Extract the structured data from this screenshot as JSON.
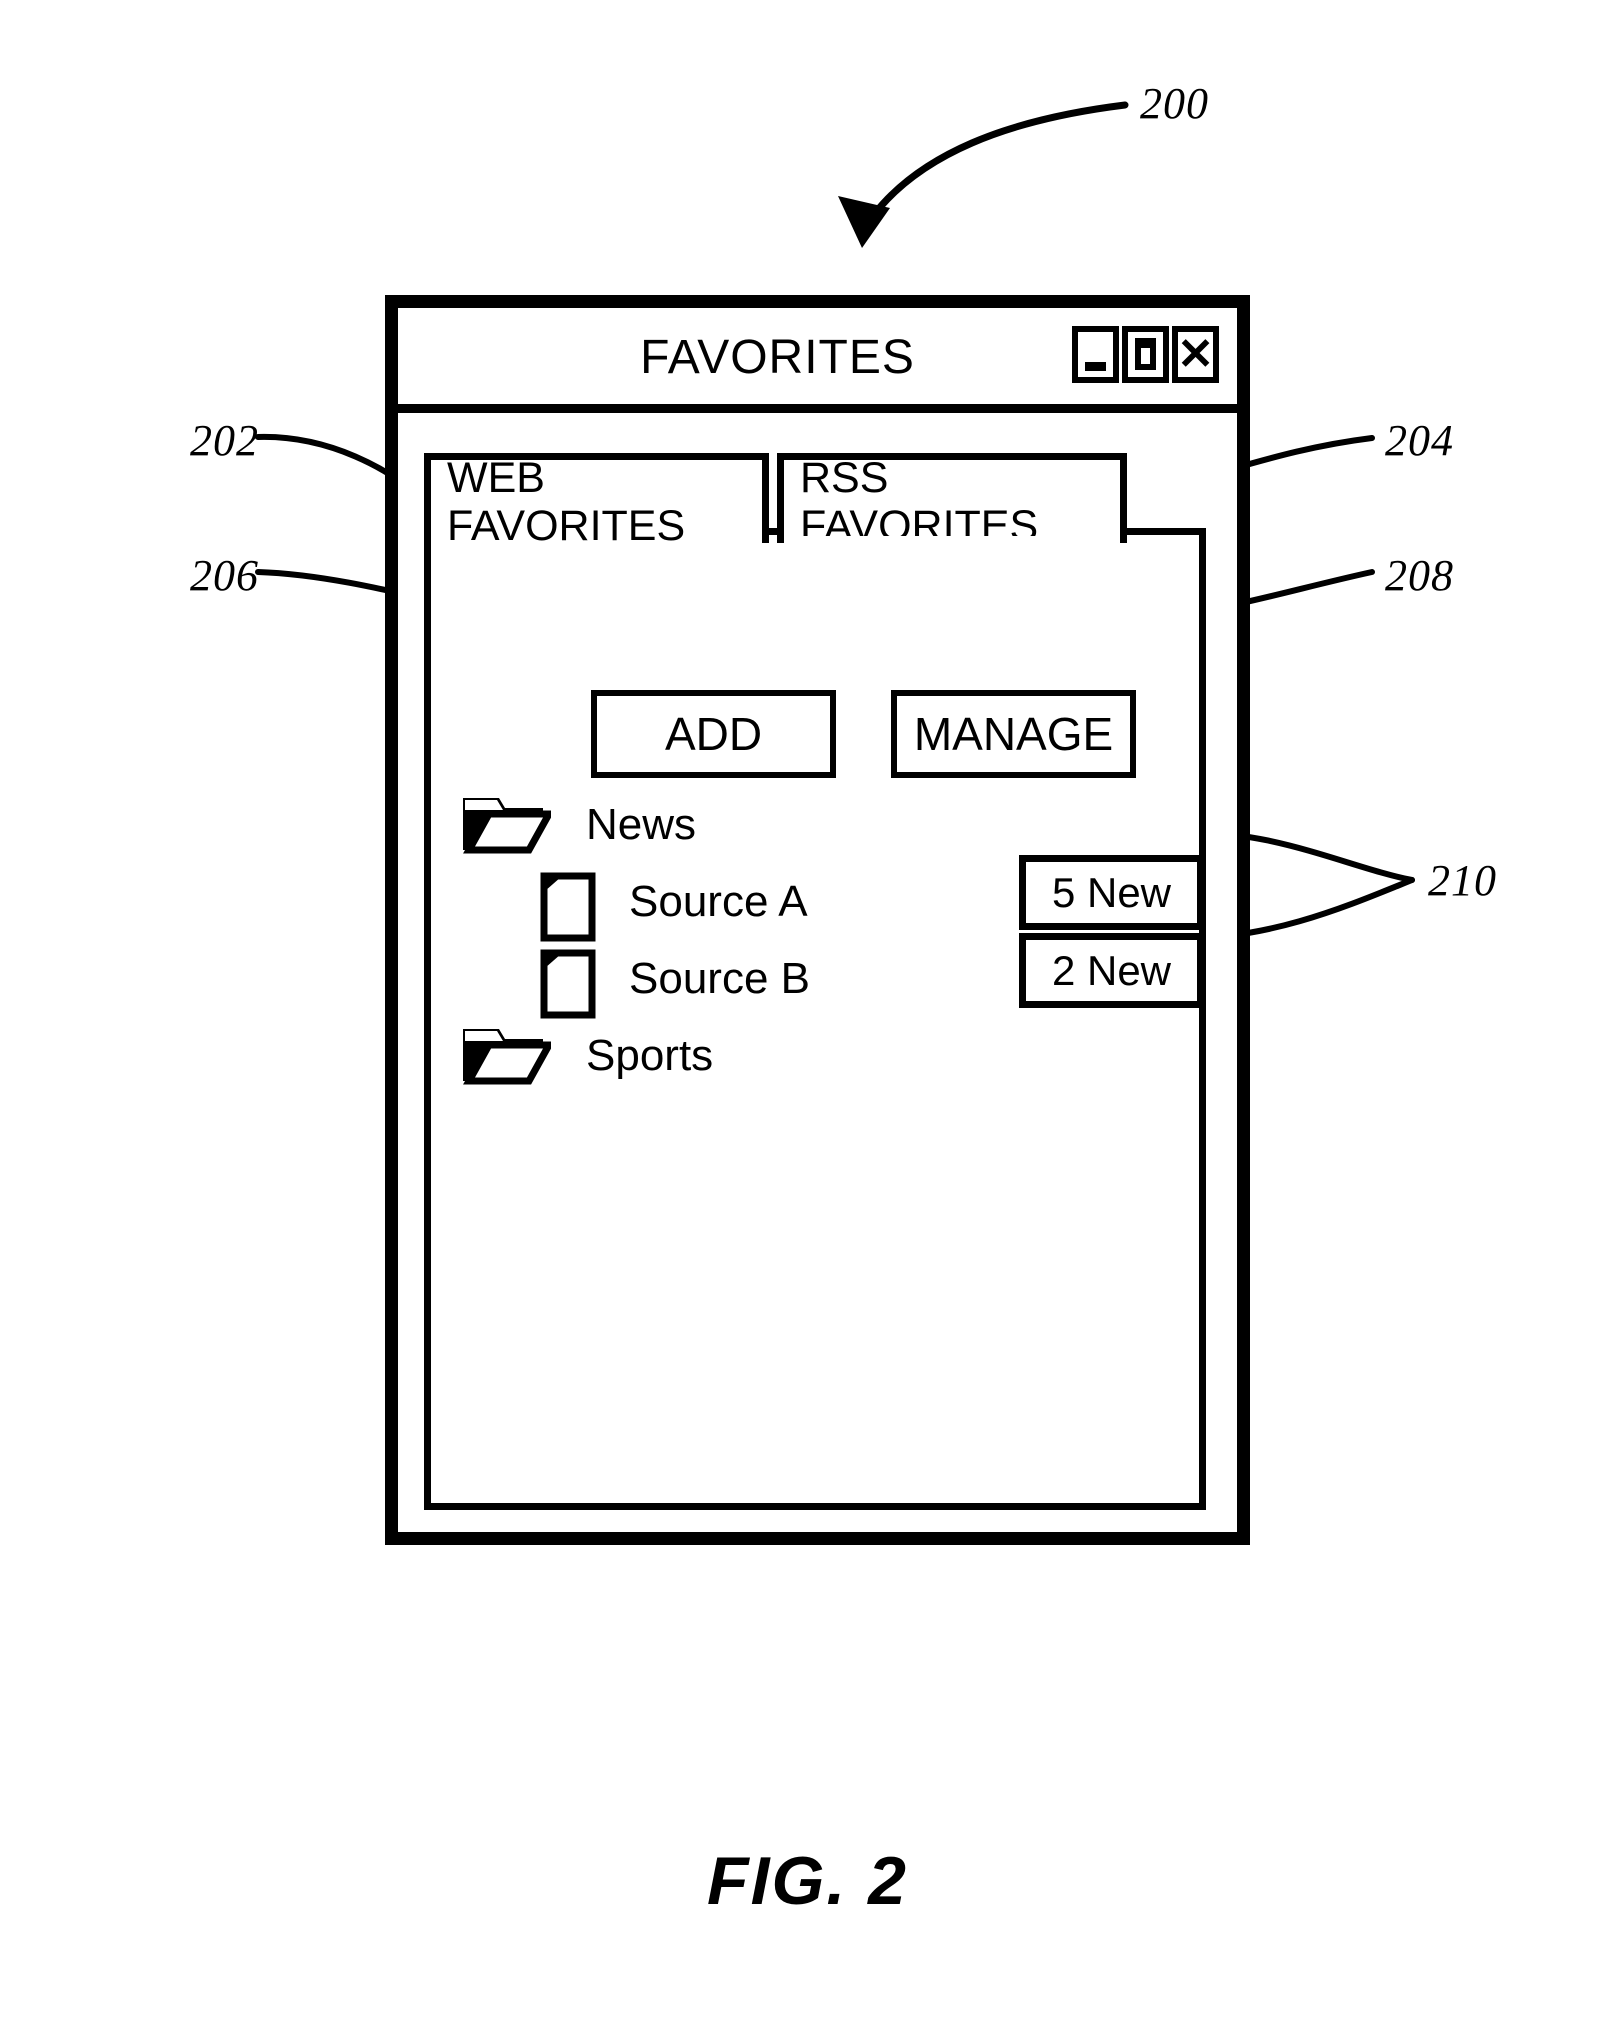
{
  "figure": {
    "caption": "FIG.  2",
    "callout_main": "200"
  },
  "window": {
    "title": "FAVORITES",
    "controls": [
      {
        "name": "minimize",
        "glyph": "_"
      },
      {
        "name": "maximize",
        "glyph": "□"
      },
      {
        "name": "close",
        "glyph": "✕"
      }
    ]
  },
  "tabs": [
    {
      "line1": "WEB",
      "line2": "FAVORITES",
      "ref": "202"
    },
    {
      "line1": "RSS",
      "line2": "FAVORITES",
      "ref": "204"
    }
  ],
  "buttons": [
    {
      "label": "ADD",
      "ref": "206"
    },
    {
      "label": "MANAGE",
      "ref": "208"
    }
  ],
  "tree": {
    "items": [
      {
        "label": "News",
        "icon": "folder-icon",
        "level": 0
      },
      {
        "label": "Source A",
        "icon": "document-icon",
        "level": 1
      },
      {
        "label": "Source B",
        "icon": "document-icon",
        "level": 1
      },
      {
        "label": "Sports",
        "icon": "folder-icon",
        "level": 0
      }
    ]
  },
  "badges": {
    "ref": "210",
    "items": [
      {
        "label": "5 New"
      },
      {
        "label": "2 New"
      }
    ]
  },
  "colors": {
    "ink": "#000000",
    "paper": "#ffffff"
  }
}
